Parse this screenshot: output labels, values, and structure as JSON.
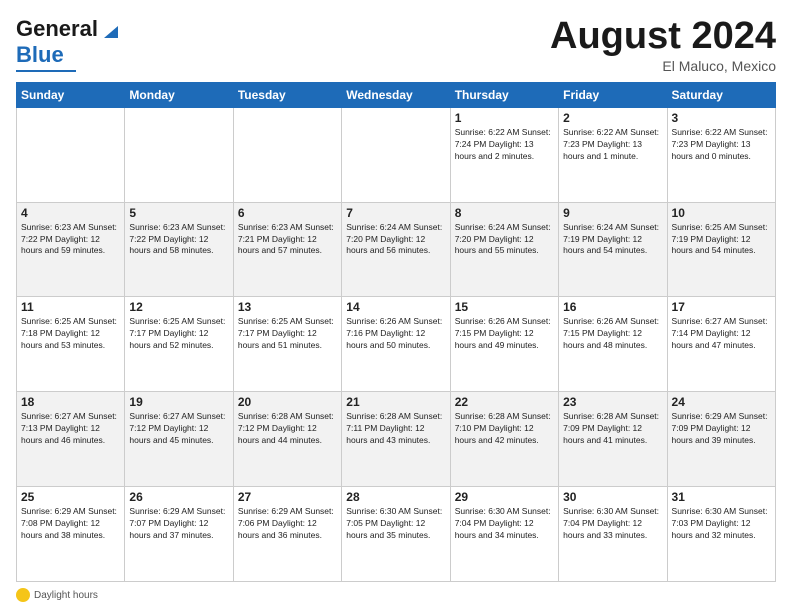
{
  "header": {
    "logo_line1": "General",
    "logo_line2": "Blue",
    "month_title": "August 2024",
    "location": "El Maluco, Mexico"
  },
  "weekdays": [
    "Sunday",
    "Monday",
    "Tuesday",
    "Wednesday",
    "Thursday",
    "Friday",
    "Saturday"
  ],
  "weeks": [
    [
      {
        "day": "",
        "detail": ""
      },
      {
        "day": "",
        "detail": ""
      },
      {
        "day": "",
        "detail": ""
      },
      {
        "day": "",
        "detail": ""
      },
      {
        "day": "1",
        "detail": "Sunrise: 6:22 AM\nSunset: 7:24 PM\nDaylight: 13 hours\nand 2 minutes."
      },
      {
        "day": "2",
        "detail": "Sunrise: 6:22 AM\nSunset: 7:23 PM\nDaylight: 13 hours\nand 1 minute."
      },
      {
        "day": "3",
        "detail": "Sunrise: 6:22 AM\nSunset: 7:23 PM\nDaylight: 13 hours\nand 0 minutes."
      }
    ],
    [
      {
        "day": "4",
        "detail": "Sunrise: 6:23 AM\nSunset: 7:22 PM\nDaylight: 12 hours\nand 59 minutes."
      },
      {
        "day": "5",
        "detail": "Sunrise: 6:23 AM\nSunset: 7:22 PM\nDaylight: 12 hours\nand 58 minutes."
      },
      {
        "day": "6",
        "detail": "Sunrise: 6:23 AM\nSunset: 7:21 PM\nDaylight: 12 hours\nand 57 minutes."
      },
      {
        "day": "7",
        "detail": "Sunrise: 6:24 AM\nSunset: 7:20 PM\nDaylight: 12 hours\nand 56 minutes."
      },
      {
        "day": "8",
        "detail": "Sunrise: 6:24 AM\nSunset: 7:20 PM\nDaylight: 12 hours\nand 55 minutes."
      },
      {
        "day": "9",
        "detail": "Sunrise: 6:24 AM\nSunset: 7:19 PM\nDaylight: 12 hours\nand 54 minutes."
      },
      {
        "day": "10",
        "detail": "Sunrise: 6:25 AM\nSunset: 7:19 PM\nDaylight: 12 hours\nand 54 minutes."
      }
    ],
    [
      {
        "day": "11",
        "detail": "Sunrise: 6:25 AM\nSunset: 7:18 PM\nDaylight: 12 hours\nand 53 minutes."
      },
      {
        "day": "12",
        "detail": "Sunrise: 6:25 AM\nSunset: 7:17 PM\nDaylight: 12 hours\nand 52 minutes."
      },
      {
        "day": "13",
        "detail": "Sunrise: 6:25 AM\nSunset: 7:17 PM\nDaylight: 12 hours\nand 51 minutes."
      },
      {
        "day": "14",
        "detail": "Sunrise: 6:26 AM\nSunset: 7:16 PM\nDaylight: 12 hours\nand 50 minutes."
      },
      {
        "day": "15",
        "detail": "Sunrise: 6:26 AM\nSunset: 7:15 PM\nDaylight: 12 hours\nand 49 minutes."
      },
      {
        "day": "16",
        "detail": "Sunrise: 6:26 AM\nSunset: 7:15 PM\nDaylight: 12 hours\nand 48 minutes."
      },
      {
        "day": "17",
        "detail": "Sunrise: 6:27 AM\nSunset: 7:14 PM\nDaylight: 12 hours\nand 47 minutes."
      }
    ],
    [
      {
        "day": "18",
        "detail": "Sunrise: 6:27 AM\nSunset: 7:13 PM\nDaylight: 12 hours\nand 46 minutes."
      },
      {
        "day": "19",
        "detail": "Sunrise: 6:27 AM\nSunset: 7:12 PM\nDaylight: 12 hours\nand 45 minutes."
      },
      {
        "day": "20",
        "detail": "Sunrise: 6:28 AM\nSunset: 7:12 PM\nDaylight: 12 hours\nand 44 minutes."
      },
      {
        "day": "21",
        "detail": "Sunrise: 6:28 AM\nSunset: 7:11 PM\nDaylight: 12 hours\nand 43 minutes."
      },
      {
        "day": "22",
        "detail": "Sunrise: 6:28 AM\nSunset: 7:10 PM\nDaylight: 12 hours\nand 42 minutes."
      },
      {
        "day": "23",
        "detail": "Sunrise: 6:28 AM\nSunset: 7:09 PM\nDaylight: 12 hours\nand 41 minutes."
      },
      {
        "day": "24",
        "detail": "Sunrise: 6:29 AM\nSunset: 7:09 PM\nDaylight: 12 hours\nand 39 minutes."
      }
    ],
    [
      {
        "day": "25",
        "detail": "Sunrise: 6:29 AM\nSunset: 7:08 PM\nDaylight: 12 hours\nand 38 minutes."
      },
      {
        "day": "26",
        "detail": "Sunrise: 6:29 AM\nSunset: 7:07 PM\nDaylight: 12 hours\nand 37 minutes."
      },
      {
        "day": "27",
        "detail": "Sunrise: 6:29 AM\nSunset: 7:06 PM\nDaylight: 12 hours\nand 36 minutes."
      },
      {
        "day": "28",
        "detail": "Sunrise: 6:30 AM\nSunset: 7:05 PM\nDaylight: 12 hours\nand 35 minutes."
      },
      {
        "day": "29",
        "detail": "Sunrise: 6:30 AM\nSunset: 7:04 PM\nDaylight: 12 hours\nand 34 minutes."
      },
      {
        "day": "30",
        "detail": "Sunrise: 6:30 AM\nSunset: 7:04 PM\nDaylight: 12 hours\nand 33 minutes."
      },
      {
        "day": "31",
        "detail": "Sunrise: 6:30 AM\nSunset: 7:03 PM\nDaylight: 12 hours\nand 32 minutes."
      }
    ]
  ],
  "footer": {
    "daylight_label": "Daylight hours"
  }
}
